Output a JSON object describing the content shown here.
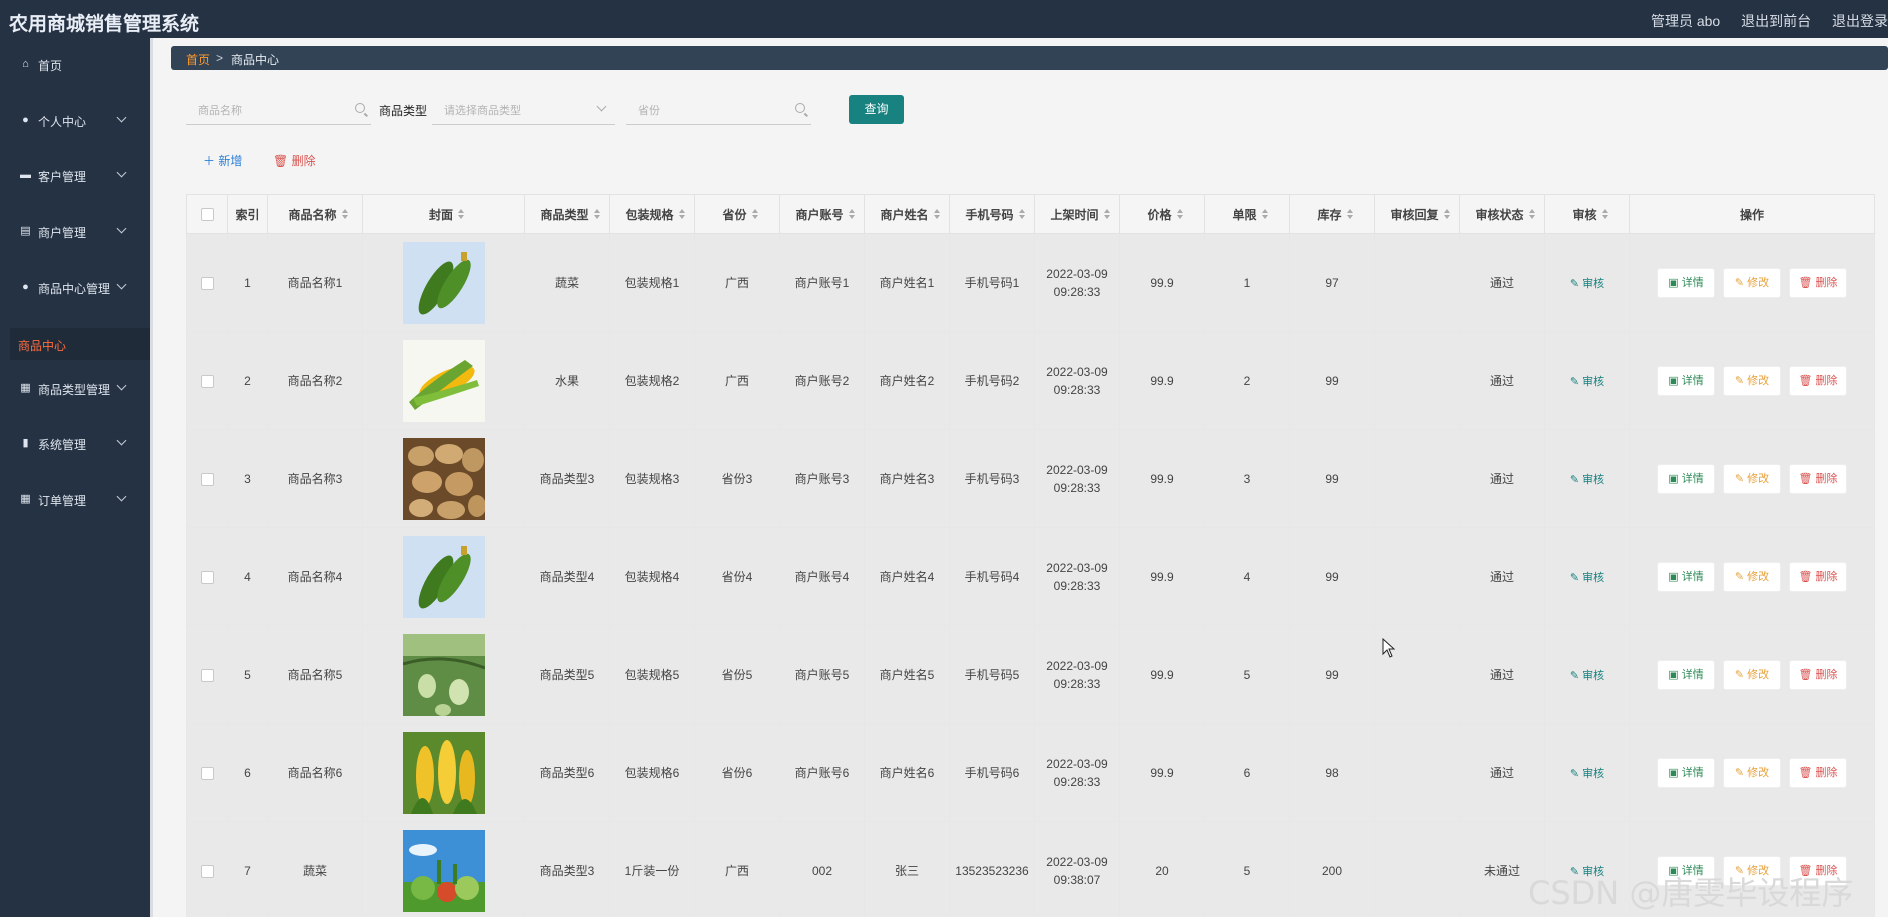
{
  "app": {
    "title": "农用商城销售管理系统"
  },
  "topbar": {
    "admin": "管理员 abo",
    "to_front": "退出到前台",
    "logout": "退出登录"
  },
  "sidebar": {
    "items": [
      {
        "label": "首页",
        "icon": "home-icon",
        "chevron": false
      },
      {
        "label": "个人中心",
        "icon": "user-icon",
        "chevron": true
      },
      {
        "label": "客户管理",
        "icon": "id-card-icon",
        "chevron": true
      },
      {
        "label": "商户管理",
        "icon": "document-icon",
        "chevron": true
      },
      {
        "label": "商品中心管理",
        "icon": "user-icon",
        "chevron": true
      },
      {
        "label": "商品类型管理",
        "icon": "grid-icon",
        "chevron": true
      },
      {
        "label": "系统管理",
        "icon": "bar-chart-icon",
        "chevron": true
      },
      {
        "label": "订单管理",
        "icon": "grid-icon",
        "chevron": true
      }
    ],
    "active_sub": "商品中心"
  },
  "breadcrumb": {
    "home": "首页",
    "sep": ">",
    "current": "商品中心"
  },
  "search": {
    "name_placeholder": "商品名称",
    "type_label": "商品类型",
    "type_placeholder": "请选择商品类型",
    "province_placeholder": "省份",
    "query_button": "查询"
  },
  "actions": {
    "add": "新增",
    "delete": "删除"
  },
  "table": {
    "headers": [
      "索引",
      "商品名称",
      "封面",
      "商品类型",
      "包装规格",
      "省份",
      "商户账号",
      "商户姓名",
      "手机号码",
      "上架时间",
      "价格",
      "单限",
      "库存",
      "审核回复",
      "审核状态",
      "审核",
      "操作"
    ],
    "audit_label": "审核",
    "op_detail": "详情",
    "op_edit": "修改",
    "op_delete": "删除",
    "rows": [
      {
        "index": "1",
        "name": "商品名称1",
        "cover": "cucumber",
        "type": "蔬菜",
        "spec": "包装规格1",
        "province": "广西",
        "account": "商户账号1",
        "merchant": "商户姓名1",
        "phone": "手机号码1",
        "date": "2022-03-09",
        "time": "09:28:33",
        "price": "99.9",
        "limit": "1",
        "stock": "97",
        "reply": "",
        "status": "通过"
      },
      {
        "index": "2",
        "name": "商品名称2",
        "cover": "corn",
        "type": "水果",
        "spec": "包装规格2",
        "province": "广西",
        "account": "商户账号2",
        "merchant": "商户姓名2",
        "phone": "手机号码2",
        "date": "2022-03-09",
        "time": "09:28:33",
        "price": "99.9",
        "limit": "2",
        "stock": "99",
        "reply": "",
        "status": "通过"
      },
      {
        "index": "3",
        "name": "商品名称3",
        "cover": "potato",
        "type": "商品类型3",
        "spec": "包装规格3",
        "province": "省份3",
        "account": "商户账号3",
        "merchant": "商户姓名3",
        "phone": "手机号码3",
        "date": "2022-03-09",
        "time": "09:28:33",
        "price": "99.9",
        "limit": "3",
        "stock": "99",
        "reply": "",
        "status": "通过"
      },
      {
        "index": "4",
        "name": "商品名称4",
        "cover": "cucumber",
        "type": "商品类型4",
        "spec": "包装规格4",
        "province": "省份4",
        "account": "商户账号4",
        "merchant": "商户姓名4",
        "phone": "手机号码4",
        "date": "2022-03-09",
        "time": "09:28:33",
        "price": "99.9",
        "limit": "4",
        "stock": "99",
        "reply": "",
        "status": "通过"
      },
      {
        "index": "5",
        "name": "商品名称5",
        "cover": "gourd",
        "type": "商品类型5",
        "spec": "包装规格5",
        "province": "省份5",
        "account": "商户账号5",
        "merchant": "商户姓名5",
        "phone": "手机号码5",
        "date": "2022-03-09",
        "time": "09:28:33",
        "price": "99.9",
        "limit": "5",
        "stock": "99",
        "reply": "",
        "status": "通过"
      },
      {
        "index": "6",
        "name": "商品名称6",
        "cover": "corn-field",
        "type": "商品类型6",
        "spec": "包装规格6",
        "province": "省份6",
        "account": "商户账号6",
        "merchant": "商户姓名6",
        "phone": "手机号码6",
        "date": "2022-03-09",
        "time": "09:28:33",
        "price": "99.9",
        "limit": "6",
        "stock": "98",
        "reply": "",
        "status": "通过"
      },
      {
        "index": "7",
        "name": "蔬菜",
        "cover": "vegetables",
        "type": "商品类型3",
        "spec": "1斤装一份",
        "province": "广西",
        "account": "002",
        "merchant": "张三",
        "phone": "13523523236",
        "date": "2022-03-09",
        "time": "09:38:07",
        "price": "20",
        "limit": "5",
        "stock": "200",
        "reply": "",
        "status": "未通过"
      }
    ]
  },
  "watermark": "CSDN @唐雯毕设程序",
  "colors": {
    "sidebar": "#253243",
    "accent": "#17827f",
    "active": "#ff6b3d",
    "breadcrumb_home": "#ff9a2e"
  }
}
